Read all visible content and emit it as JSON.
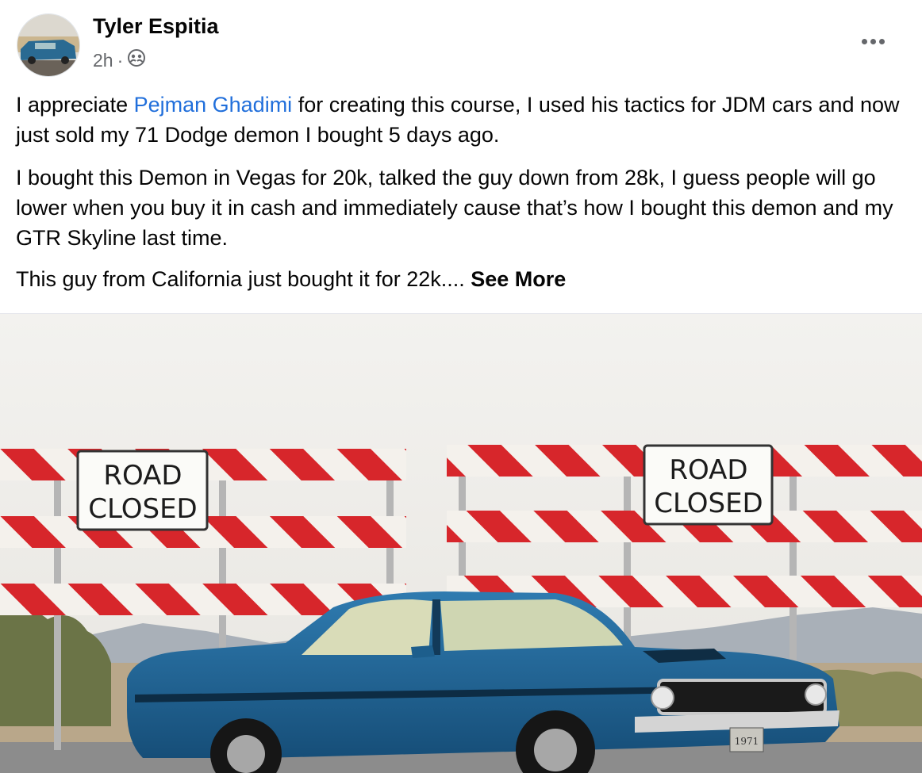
{
  "post": {
    "author": "Tyler Espitia",
    "time": "2h",
    "separator": "·",
    "audience_icon": "friends-globe-icon",
    "more_icon": "more-options-icon",
    "paragraph1": {
      "before": "I appreciate ",
      "mention": "Pejman Ghadimi",
      "after": " for creating this course, I used his tactics for JDM cars and now just sold my 71 Dodge demon I bought 5 days ago."
    },
    "paragraph2": "I bought this Demon in Vegas for 20k, talked the guy down from 28k, I guess people will go lower when you buy it in cash and immediately cause that’s how I bought this demon and my GTR Skyline last time.",
    "paragraph3": {
      "text": "This guy from California just bought it for 22k.... ",
      "see_more": "See More"
    }
  },
  "photo": {
    "sign_left": [
      "ROAD",
      "CLOSED"
    ],
    "sign_right": [
      "ROAD",
      "CLOSED"
    ],
    "plate": "1971"
  },
  "colors": {
    "mention": "#216fdb",
    "secondary": "#65676b",
    "car_blue": "#1d5e8c",
    "barrier_red": "#d7262b"
  }
}
